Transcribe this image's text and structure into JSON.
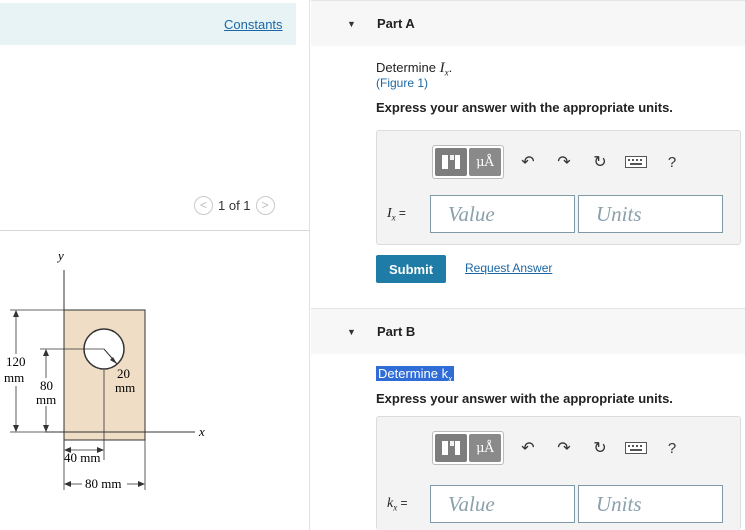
{
  "left": {
    "constants_link": "Constants",
    "pager": {
      "prev": "<",
      "label": "1 of 1",
      "next": ">"
    }
  },
  "figure": {
    "y_axis": "y",
    "x_axis": "x",
    "dim_120": "120",
    "dim_120_unit": "mm",
    "dim_80": "80",
    "dim_80_unit": "mm",
    "dim_20": "20",
    "dim_20_unit": "mm",
    "dim_40": "40 mm",
    "dim_80_bottom": "80 mm",
    "plate_color": "#efddc6"
  },
  "partA": {
    "header": "Part A",
    "question_prefix": "Determine ",
    "question_var": "I",
    "question_sub": "x",
    "question_suffix": ".",
    "figure_link": "(Figure 1)",
    "instruction": "Express your answer with the appropriate units.",
    "answer_label_var": "I",
    "answer_label_sub": "x",
    "answer_equals": "=",
    "value_placeholder": "Value",
    "units_placeholder": "Units",
    "submit_label": "Submit",
    "request_answer_label": "Request Answer",
    "mu_label": "μÅ",
    "help_label": "?"
  },
  "partB": {
    "header": "Part B",
    "question_highlight": "Determine k",
    "question_sub": "x",
    "instruction": "Express your answer with the appropriate units.",
    "answer_label_var": "k",
    "answer_label_sub": "x",
    "answer_equals": "=",
    "value_placeholder": "Value",
    "units_placeholder": "Units",
    "mu_label": "μÅ",
    "help_label": "?"
  },
  "colors": {
    "accent": "#1e7ca6",
    "link": "#1b67a5",
    "highlight": "#2f6cd6"
  }
}
